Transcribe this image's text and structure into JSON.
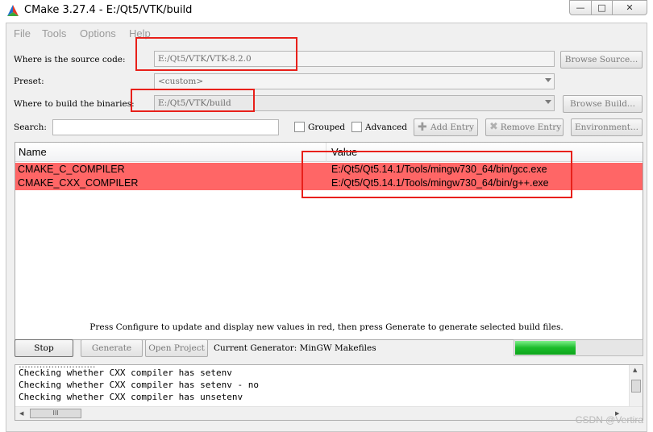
{
  "window": {
    "title": "CMake 3.27.4 - E:/Qt5/VTK/build",
    "minimize_glyph": "—",
    "maximize_glyph": "□",
    "close_glyph": "✕"
  },
  "menu": {
    "items": [
      "File",
      "Tools",
      "Options",
      "Help"
    ]
  },
  "source": {
    "label": "Where is the source code:",
    "value": "E:/Qt5/VTK/VTK-8.2.0",
    "browse_label": "Browse Source..."
  },
  "preset": {
    "label": "Preset:",
    "value": "<custom>"
  },
  "build": {
    "label": "Where to build the binaries:",
    "value": "E:/Qt5/VTK/build",
    "browse_label": "Browse Build..."
  },
  "search": {
    "label": "Search:",
    "value": "",
    "grouped_label": "Grouped",
    "advanced_label": "Advanced",
    "add_entry_label": "Add Entry",
    "remove_entry_label": "Remove Entry",
    "environment_label": "Environment..."
  },
  "table": {
    "headers": {
      "name": "Name",
      "value": "Value"
    },
    "rows": [
      {
        "name": "CMAKE_C_COMPILER",
        "value": "E:/Qt5/Qt5.14.1/Tools/mingw730_64/bin/gcc.exe"
      },
      {
        "name": "CMAKE_CXX_COMPILER",
        "value": "E:/Qt5/Qt5.14.1/Tools/mingw730_64/bin/g++.exe"
      }
    ],
    "row_color": "#ff6666"
  },
  "hint": "Press Configure to update and display new values in red, then press Generate to generate selected build files.",
  "actions": {
    "stop_label": "Stop",
    "generate_label": "Generate",
    "open_project_label": "Open Project",
    "generator_text": "Current Generator: MinGW Makefiles"
  },
  "progress": {
    "fraction": 0.48,
    "color": "#1bbc2b"
  },
  "log": {
    "lines": [
      "Checking whether CXX compiler has setenv",
      "Checking whether CXX compiler has setenv - no",
      "Checking whether CXX compiler has unsetenv"
    ],
    "hscroll_grip": "III"
  },
  "annotation_color": "#e8201a",
  "watermark": "CSDN @Vertira"
}
